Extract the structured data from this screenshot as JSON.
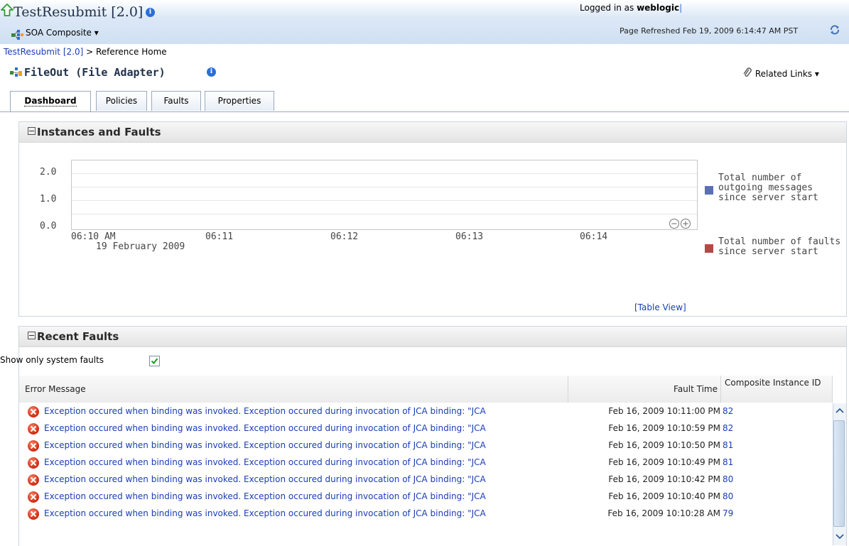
{
  "header": {
    "app_title": "TestResubmit [2.0]",
    "composite_menu": "SOA Composite ▾",
    "logged_in_label": "Logged in as",
    "username": "weblogic",
    "refresh_text": "Page Refreshed Feb 19, 2009 6:14:47 AM PST"
  },
  "breadcrumb": {
    "parent": "TestResubmit [2.0]",
    "separator": " > ",
    "current": "Reference Home"
  },
  "reference": {
    "title": "FileOut (File Adapter)",
    "related_links": "Related Links ▾"
  },
  "tabs": [
    {
      "label": "Dashboard",
      "active": true
    },
    {
      "label": "Policies",
      "active": false
    },
    {
      "label": "Faults",
      "active": false
    },
    {
      "label": "Properties",
      "active": false
    }
  ],
  "instances_panel": {
    "title": "Instances and Faults",
    "table_view_link": "[Table View]"
  },
  "chart_data": {
    "type": "line",
    "y_ticks": [
      "2.0",
      "1.0",
      "0.0"
    ],
    "ylim": [
      0,
      2.5
    ],
    "x_ticks": [
      "06:10 AM",
      "06:11",
      "06:12",
      "06:13",
      "06:14"
    ],
    "x_sub_label": "19 February 2009",
    "grid": true,
    "legend_position": "right",
    "series": [
      {
        "name": "Total number of outgoing messages since server start",
        "legend_lines": [
          "Total number of",
          "outgoing messages",
          "since server start"
        ],
        "color": "#5b6fb7",
        "values": []
      },
      {
        "name": "Total number of faults since server start",
        "legend_lines": [
          "Total number of faults",
          "since server start"
        ],
        "color": "#b44a45",
        "values": []
      }
    ]
  },
  "recent_faults": {
    "title": "Recent Faults",
    "system_faults_label": "Show only system faults",
    "system_faults_checked": true,
    "columns": [
      "Error Message",
      "Fault Time",
      "Composite Instance ID"
    ],
    "rows": [
      {
        "message": "Exception occured when binding was invoked. Exception occured during invocation of JCA binding: \"JCA",
        "time": "Feb 16, 2009 10:11:00 PM",
        "id": "82"
      },
      {
        "message": "Exception occured when binding was invoked. Exception occured during invocation of JCA binding: \"JCA",
        "time": "Feb 16, 2009 10:10:59 PM",
        "id": "82"
      },
      {
        "message": "Exception occured when binding was invoked. Exception occured during invocation of JCA binding: \"JCA",
        "time": "Feb 16, 2009 10:10:50 PM",
        "id": "81"
      },
      {
        "message": "Exception occured when binding was invoked. Exception occured during invocation of JCA binding: \"JCA",
        "time": "Feb 16, 2009 10:10:49 PM",
        "id": "81"
      },
      {
        "message": "Exception occured when binding was invoked. Exception occured during invocation of JCA binding: \"JCA",
        "time": "Feb 16, 2009 10:10:42 PM",
        "id": "80"
      },
      {
        "message": "Exception occured when binding was invoked. Exception occured during invocation of JCA binding: \"JCA",
        "time": "Feb 16, 2009 10:10:40 PM",
        "id": "80"
      },
      {
        "message": "Exception occured when binding was invoked. Exception occured during invocation of JCA binding: \"JCA",
        "time": "Feb 16, 2009 10:10:28 AM",
        "id": "79"
      }
    ]
  }
}
